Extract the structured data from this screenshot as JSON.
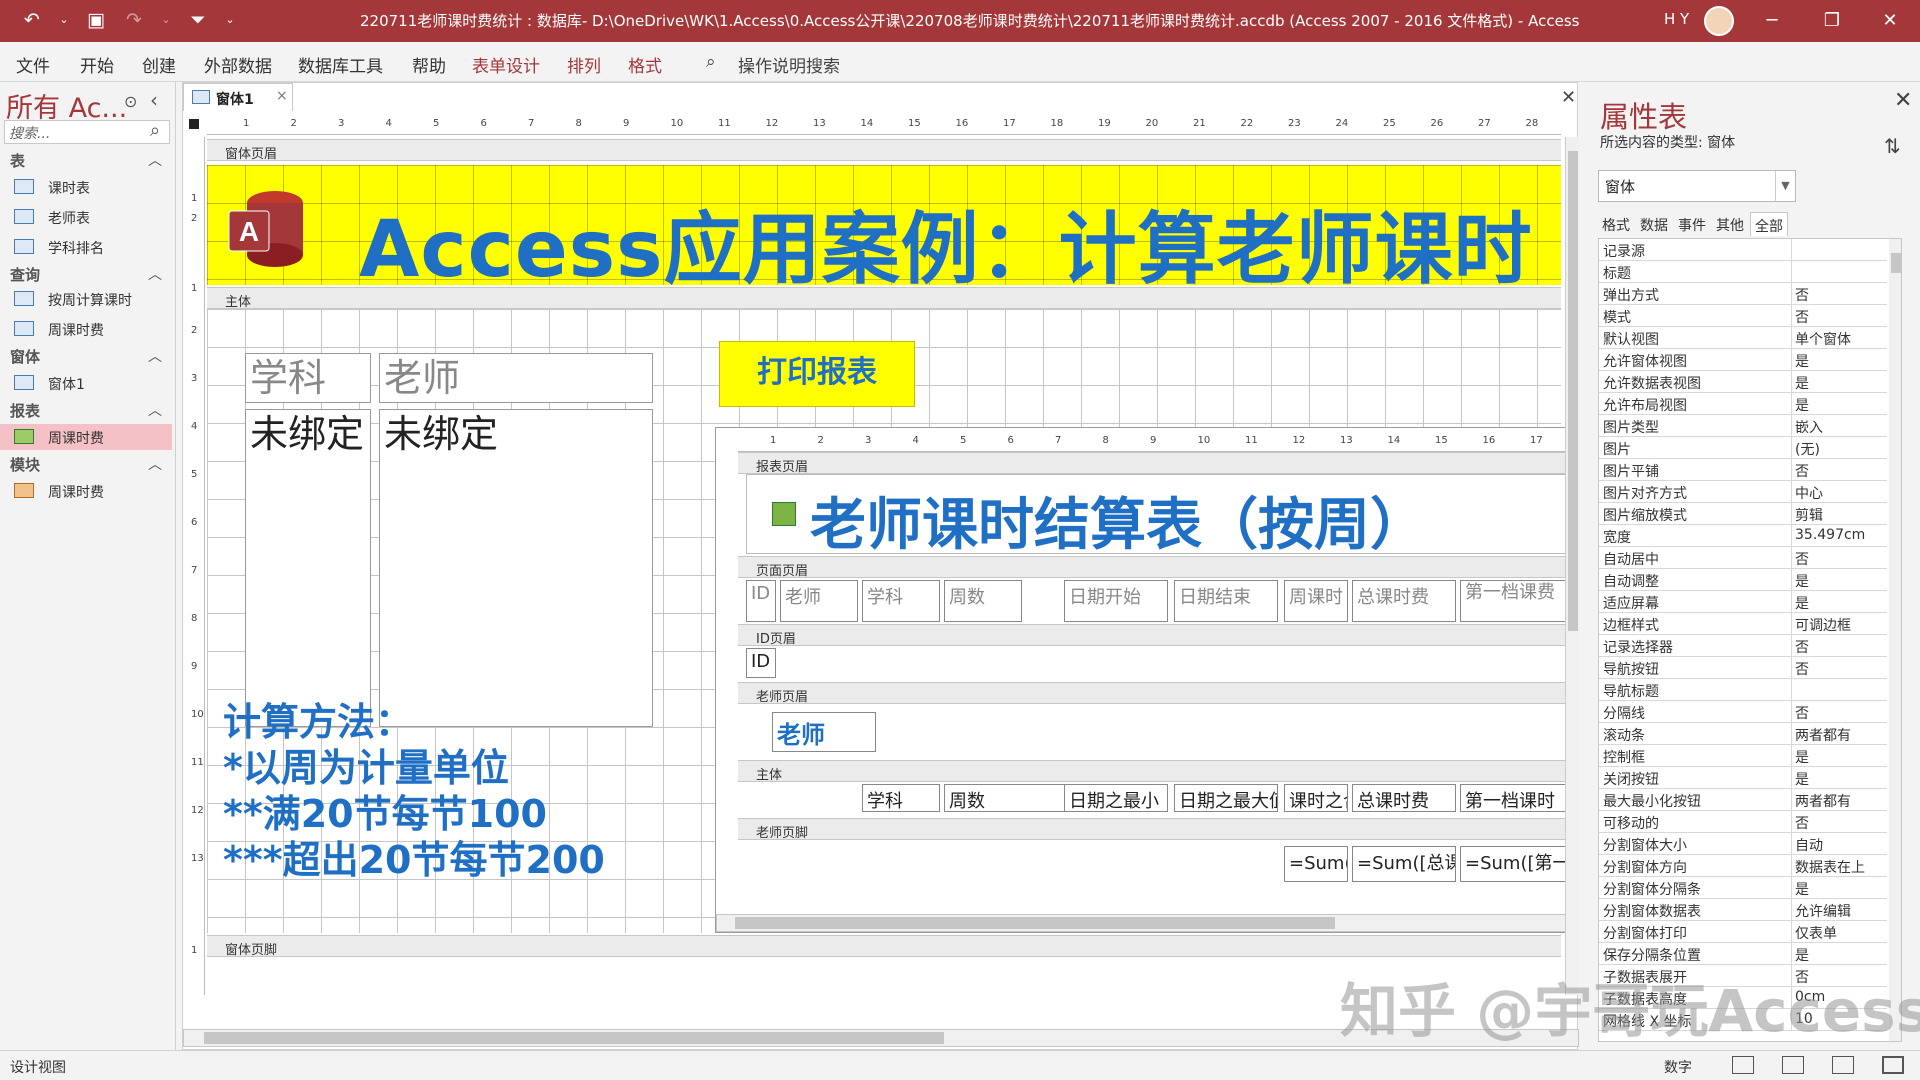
{
  "titlebar": {
    "title": "220711老师课时费统计 : 数据库- D:\\OneDrive\\WK\\1.Access\\0.Access公开课\\220708老师课时费统计\\220711老师课时费统计.accdb (Access 2007 - 2016 文件格式) - Access",
    "user": "H Y"
  },
  "ribbon": {
    "tabs": [
      "文件",
      "开始",
      "创建",
      "外部数据",
      "数据库工具",
      "帮助",
      "表单设计",
      "排列",
      "格式"
    ],
    "tell_me": "操作说明搜索"
  },
  "nav": {
    "title": "所有 Ac...",
    "search_placeholder": "搜索...",
    "groups": [
      {
        "label": "表",
        "items": [
          "课时表",
          "老师表",
          "学科排名"
        ]
      },
      {
        "label": "查询",
        "items": [
          "按周计算课时",
          "周课时费"
        ]
      },
      {
        "label": "窗体",
        "items": [
          "窗体1"
        ]
      },
      {
        "label": "报表",
        "items": [
          "周课时费"
        ]
      },
      {
        "label": "模块",
        "items": [
          "周课时费"
        ]
      }
    ]
  },
  "document": {
    "tab_label": "窗体1",
    "ruler_numbers": [
      "1",
      "2",
      "3",
      "4",
      "5",
      "6",
      "7",
      "8",
      "9",
      "10",
      "11",
      "12",
      "13",
      "14",
      "15",
      "16",
      "17",
      "18",
      "19",
      "20",
      "21",
      "22",
      "23",
      "24",
      "25",
      "26",
      "27",
      "28"
    ],
    "vruler_numbers": [
      "1",
      "2",
      "1",
      "2",
      "3",
      "4",
      "5",
      "6",
      "7",
      "8",
      "9",
      "10",
      "11",
      "12",
      "13",
      "1"
    ],
    "sections": {
      "form_header": "窗体页眉",
      "detail": "主体",
      "form_footer": "窗体页脚"
    },
    "header_title": "Access应用案例：计算老师课时",
    "labels": {
      "subject": "学科",
      "teacher": "老师"
    },
    "textboxes": {
      "subject": "未绑定",
      "teacher": "未绑定"
    },
    "print_button": "打印报表",
    "notes": [
      "计算方法：",
      "*以周为计量单位",
      "**满20节每节100",
      "***超出20节每节200"
    ]
  },
  "subreport": {
    "ruler_numbers": [
      "1",
      "2",
      "3",
      "4",
      "5",
      "6",
      "7",
      "8",
      "9",
      "10",
      "11",
      "12",
      "13",
      "14",
      "15",
      "16",
      "17"
    ],
    "sections": {
      "report_header": "报表页眉",
      "page_header": "页面页眉",
      "id_header": "ID页眉",
      "teacher_header": "老师页眉",
      "detail": "主体",
      "teacher_footer": "老师页脚"
    },
    "title": "老师课时结算表（按周）",
    "page_header_cols": [
      "ID",
      "老师",
      "学科",
      "周数",
      "日期开始",
      "日期结束",
      "周课时",
      "总课时费",
      "第一档课费"
    ],
    "id_field": "ID",
    "teacher_field": "老师",
    "detail_fields": [
      "学科",
      "周数",
      "日期之最小",
      "日期之最大值",
      "课时之合计",
      "总课时费",
      "第一档课时"
    ],
    "footer_fields": [
      "=Sum([课时之",
      "=Sum([总课时费])",
      "=Sum([第一档课时"
    ]
  },
  "properties": {
    "title": "属性表",
    "selection_type": "所选内容的类型: 窗体",
    "combo_value": "窗体",
    "tabs": [
      "格式",
      "数据",
      "事件",
      "其他",
      "全部"
    ],
    "active_tab": "全部",
    "rows": [
      {
        "name": "记录源",
        "value": ""
      },
      {
        "name": "标题",
        "value": ""
      },
      {
        "name": "弹出方式",
        "value": "否"
      },
      {
        "name": "模式",
        "value": "否"
      },
      {
        "name": "默认视图",
        "value": "单个窗体"
      },
      {
        "name": "允许窗体视图",
        "value": "是"
      },
      {
        "name": "允许数据表视图",
        "value": "是"
      },
      {
        "name": "允许布局视图",
        "value": "是"
      },
      {
        "name": "图片类型",
        "value": "嵌入"
      },
      {
        "name": "图片",
        "value": "(无)"
      },
      {
        "name": "图片平铺",
        "value": "否"
      },
      {
        "name": "图片对齐方式",
        "value": "中心"
      },
      {
        "name": "图片缩放模式",
        "value": "剪辑"
      },
      {
        "name": "宽度",
        "value": "35.497cm"
      },
      {
        "name": "自动居中",
        "value": "否"
      },
      {
        "name": "自动调整",
        "value": "是"
      },
      {
        "name": "适应屏幕",
        "value": "是"
      },
      {
        "name": "边框样式",
        "value": "可调边框"
      },
      {
        "name": "记录选择器",
        "value": "否"
      },
      {
        "name": "导航按钮",
        "value": "否"
      },
      {
        "name": "导航标题",
        "value": ""
      },
      {
        "name": "分隔线",
        "value": "否"
      },
      {
        "name": "滚动条",
        "value": "两者都有"
      },
      {
        "name": "控制框",
        "value": "是"
      },
      {
        "name": "关闭按钮",
        "value": "是"
      },
      {
        "name": "最大最小化按钮",
        "value": "两者都有"
      },
      {
        "name": "可移动的",
        "value": "否"
      },
      {
        "name": "分割窗体大小",
        "value": "自动"
      },
      {
        "name": "分割窗体方向",
        "value": "数据表在上"
      },
      {
        "name": "分割窗体分隔条",
        "value": "是"
      },
      {
        "name": "分割窗体数据表",
        "value": "允许编辑"
      },
      {
        "name": "分割窗体打印",
        "value": "仅表单"
      },
      {
        "name": "保存分隔条位置",
        "value": "是"
      },
      {
        "name": "子数据表展开",
        "value": "否"
      },
      {
        "name": "子数据表高度",
        "value": "0cm"
      },
      {
        "name": "网格线 X 坐标",
        "value": "10"
      }
    ]
  },
  "statusbar": {
    "left": "设计视图",
    "right": "数字"
  },
  "watermark": "知乎 @宇哥玩Access",
  "colors": {
    "accent": "#a4373a",
    "header_yellow": "#ffff00",
    "title_blue": "#1f6fc5"
  }
}
